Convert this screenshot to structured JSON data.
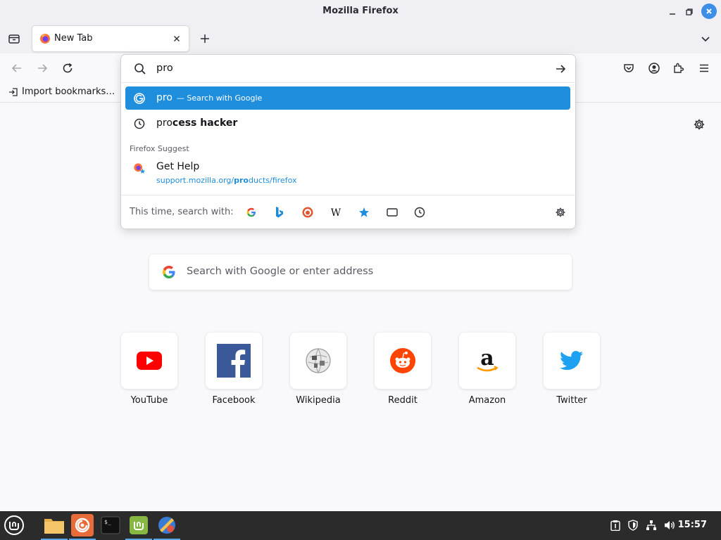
{
  "window": {
    "title": "Mozilla Firefox"
  },
  "tab": {
    "label": "New Tab"
  },
  "bookmarks": {
    "import_label": "Import bookmarks…"
  },
  "urlbar": {
    "value": "pro",
    "suggestions": [
      {
        "type": "search",
        "prefix": "pro",
        "sub": "— Search with Google"
      },
      {
        "type": "history",
        "match": "pro",
        "rest": "cess hacker"
      }
    ],
    "group_label": "Firefox Suggest",
    "firefox_suggest": {
      "title": "Get Help",
      "url_start": "support.mozilla.org/",
      "url_match": "pro",
      "url_end": "ducts/firefox"
    },
    "one_offs_label": "This time, search with:"
  },
  "newtab": {
    "search_placeholder": "Search with Google or enter address",
    "tiles": [
      {
        "name": "YouTube"
      },
      {
        "name": "Facebook"
      },
      {
        "name": "Wikipedia"
      },
      {
        "name": "Reddit"
      },
      {
        "name": "Amazon"
      },
      {
        "name": "Twitter"
      }
    ]
  },
  "taskbar": {
    "clock": "15:57"
  },
  "colors": {
    "accent": "#1f8edd",
    "taskbar": "#2b2b2b",
    "close": "#3d8ee6"
  }
}
